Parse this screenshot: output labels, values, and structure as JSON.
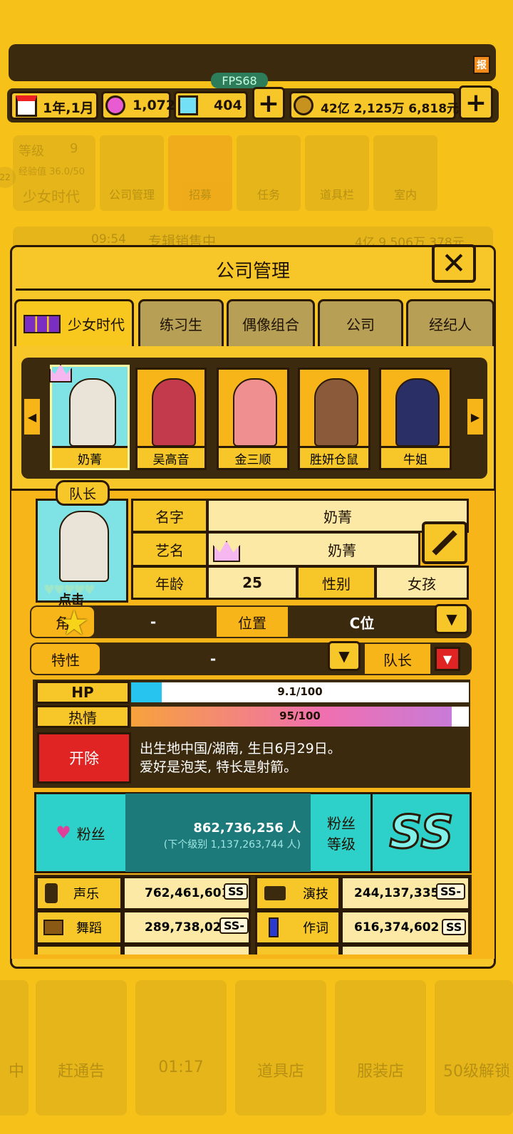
{
  "top": {
    "report_icon_label": "报",
    "fps": "FPS68",
    "date": "1年,1月",
    "gems": "1,072",
    "diamonds": "404",
    "money": "42亿 2,125万 6,818元"
  },
  "bg": {
    "level_label": "等级",
    "level_value": "9",
    "exp": "经验值 36.0/50",
    "group_name": "少女时代",
    "nav": [
      "公司管理",
      "招募",
      "任务",
      "道具栏",
      "室内"
    ],
    "ticker_time": "09:54",
    "ticker_text": "专辑销售中",
    "ticker_money": "4亿 9,506万 378元",
    "bottom_nav": [
      "中",
      "赶通告",
      "01:17",
      "道具店",
      "服装店",
      "50级解锁"
    ],
    "side_number": "22"
  },
  "dialog": {
    "title": "公司管理",
    "close_icon": "close-x-icon",
    "tabs": [
      "少女时代",
      "练习生",
      "偶像组合",
      "公司",
      "经纪人"
    ],
    "active_tab": "少女时代"
  },
  "members": [
    {
      "name": "奶菁",
      "selected": true
    },
    {
      "name": "吴高音",
      "selected": false
    },
    {
      "name": "金三顺",
      "selected": false
    },
    {
      "name": "胜妍仓鼠",
      "selected": false
    },
    {
      "name": "牛姐",
      "selected": false
    }
  ],
  "profile": {
    "leader_badge": "队长",
    "click_hint": "点击",
    "name_label": "名字",
    "name_value": "奶菁",
    "stage_label": "艺名",
    "stage_value": "奶菁",
    "age_label": "年龄",
    "age_value": "25",
    "gender_label": "性别",
    "gender_value": "女孩",
    "role_label": "角",
    "role_value": "-",
    "position_label": "位置",
    "position_value": "C位",
    "trait_label": "特性",
    "trait_value": "-",
    "leader_label": "队长",
    "hp_label": "HP",
    "hp_text": "9.1/100",
    "hp_fraction": 0.091,
    "passion_label": "热情",
    "passion_text": "95/100",
    "passion_fraction": 0.95,
    "fire_button": "开除",
    "bio_line1": "出生地中国/湖南, 生日6月29日。",
    "bio_line2": "爱好是泡芙, 特长是射箭。",
    "fans_label": "粉丝",
    "fans_value": "862,736,256 人",
    "fans_next": "(下个级别 1,137,263,744 人)",
    "fans_grade_label1": "粉丝",
    "fans_grade_label2": "等级",
    "fans_grade": "SS"
  },
  "stats": [
    {
      "label": "声乐",
      "value": "762,461,601",
      "grade": "SS"
    },
    {
      "label": "演技",
      "value": "244,137,335",
      "grade": "SS-"
    },
    {
      "label": "舞蹈",
      "value": "289,738,027",
      "grade": "SS-"
    },
    {
      "label": "作词",
      "value": "616,374,602",
      "grade": "SS"
    }
  ],
  "colors": {
    "gold": "#f7c72a",
    "dark": "#3b2a0e",
    "teal": "#2dd1c9",
    "red": "#e02323"
  }
}
